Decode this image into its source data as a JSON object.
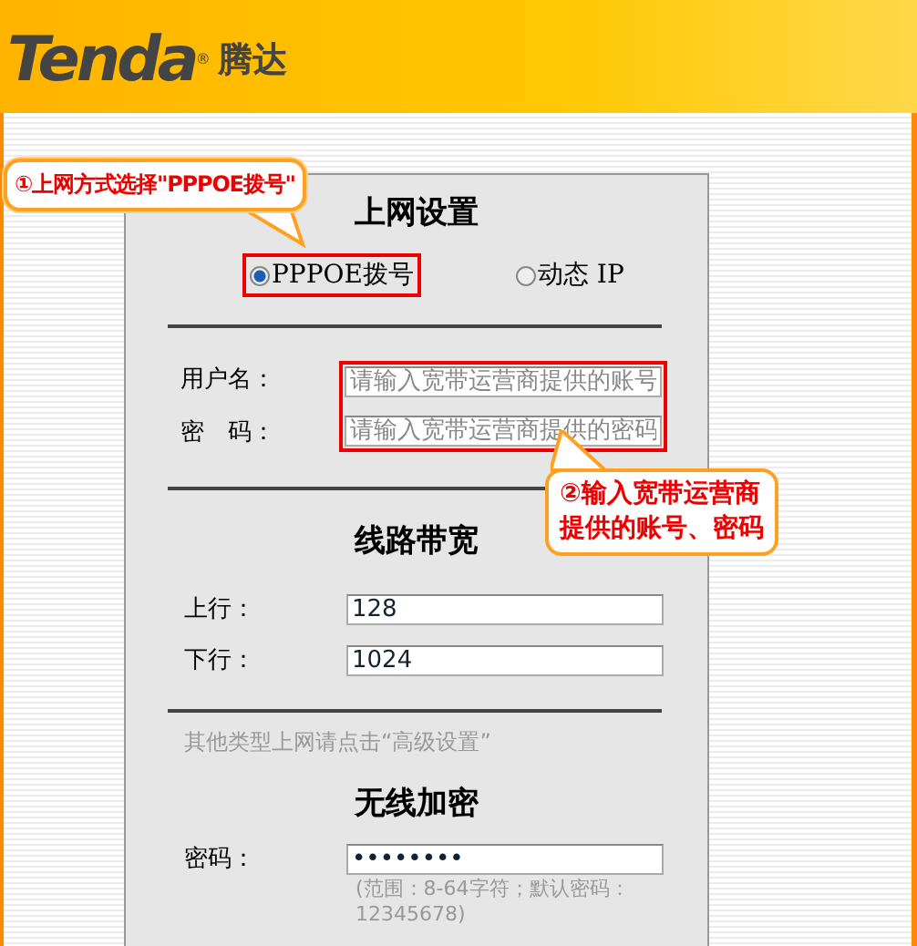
{
  "header": {
    "brand": "Tenda",
    "registered": "®",
    "brand_local": "腾达"
  },
  "internet": {
    "title": "上网设置",
    "modes": [
      {
        "label": "PPPOE拨号",
        "selected": true
      },
      {
        "label": "动态 IP",
        "selected": false
      }
    ],
    "fields": [
      {
        "label": "用户名：",
        "placeholder": "请输入宽带运营商提供的账号"
      },
      {
        "label": "密　码：",
        "placeholder": "请输入宽带运营商提供的密码"
      }
    ]
  },
  "bandwidth": {
    "title": "线路带宽",
    "fields": [
      {
        "label": "上行：",
        "value": "128"
      },
      {
        "label": "下行：",
        "value": "1024"
      }
    ]
  },
  "note": "其他类型上网请点击“高级设置”",
  "wireless": {
    "title": "无线加密",
    "fields": [
      {
        "label": "密码：",
        "value": "••••••••"
      }
    ],
    "hint": "(范围：8-64字符；默认密码：12345678)"
  },
  "callouts": [
    {
      "lines": [
        "①上网方式选择\"PPPOE拨号\""
      ]
    },
    {
      "lines": [
        "②输入宽带运营商",
        "提供的账号、密码"
      ]
    }
  ]
}
